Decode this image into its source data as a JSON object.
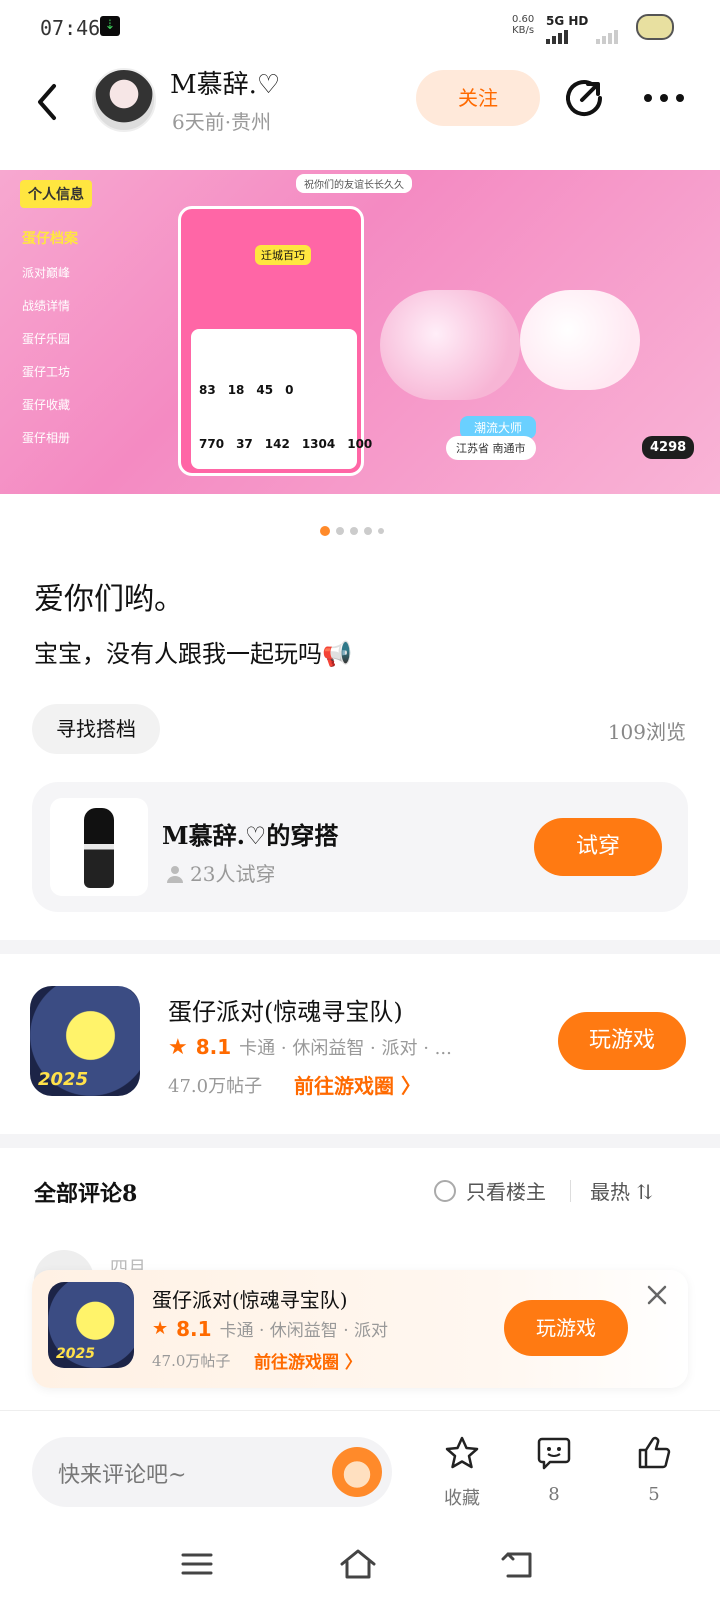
{
  "status": {
    "time": "07:46",
    "net_speed": "0.60",
    "net_unit": "KB/s",
    "signal": "5G HD"
  },
  "header": {
    "username": "M慕辞.♡",
    "meta": "6天前·贵州",
    "follow_label": "关注"
  },
  "banner": {
    "tag": "个人信息",
    "menu": [
      "蛋仔档案",
      "派对巅峰",
      "战绩详情",
      "蛋仔乐园",
      "蛋仔工坊",
      "蛋仔收藏",
      "蛋仔相册"
    ],
    "top_text": "祝你们的友谊长长久久",
    "card_badge": "迁城百巧",
    "stats_row1": [
      "83",
      "18",
      "45",
      "0"
    ],
    "stats_row2": [
      "770",
      "37",
      "142",
      "1304",
      "100"
    ],
    "master": "潮流大师",
    "location": "江苏省 南通市",
    "score": "4298",
    "dots_total": 5,
    "dots_active": 0
  },
  "post": {
    "title": "爱你们哟。",
    "body": "宝宝，没有人跟我一起玩吗📢",
    "chip": "寻找搭档",
    "views": "109浏览"
  },
  "outfit": {
    "name": "M慕辞.♡的穿搭",
    "count": "23人试穿",
    "try_label": "试穿"
  },
  "game": {
    "name": "蛋仔派对(惊魂寻宝队)",
    "rating": "8.1",
    "cats": "卡通 · 休闲益智 · 派对 · ...",
    "posts": "47.0万帖子",
    "goto": "前往游戏圈 〉",
    "play_label": "玩游戏",
    "icon_year": "2025"
  },
  "comments": {
    "label": "全部评论8",
    "only_op": "只看楼主",
    "sort": "最热 ⇅",
    "peek_name": "四月"
  },
  "popup": {
    "name": "蛋仔派对(惊魂寻宝队)",
    "rating": "8.1",
    "cats": "卡通 · 休闲益智 · 派对",
    "posts": "47.0万帖子",
    "goto": "前往游戏圈 〉",
    "play_label": "玩游戏"
  },
  "bottom": {
    "placeholder": "快来评论吧~",
    "fav_label": "收藏",
    "comment_count": "8",
    "like_count": "5"
  },
  "icons": {
    "back": "back-arrow-icon",
    "share": "share-icon",
    "more": "more-icon",
    "star": "star-icon",
    "comment": "comment-icon",
    "like": "thumbs-up-icon",
    "close": "close-icon"
  }
}
